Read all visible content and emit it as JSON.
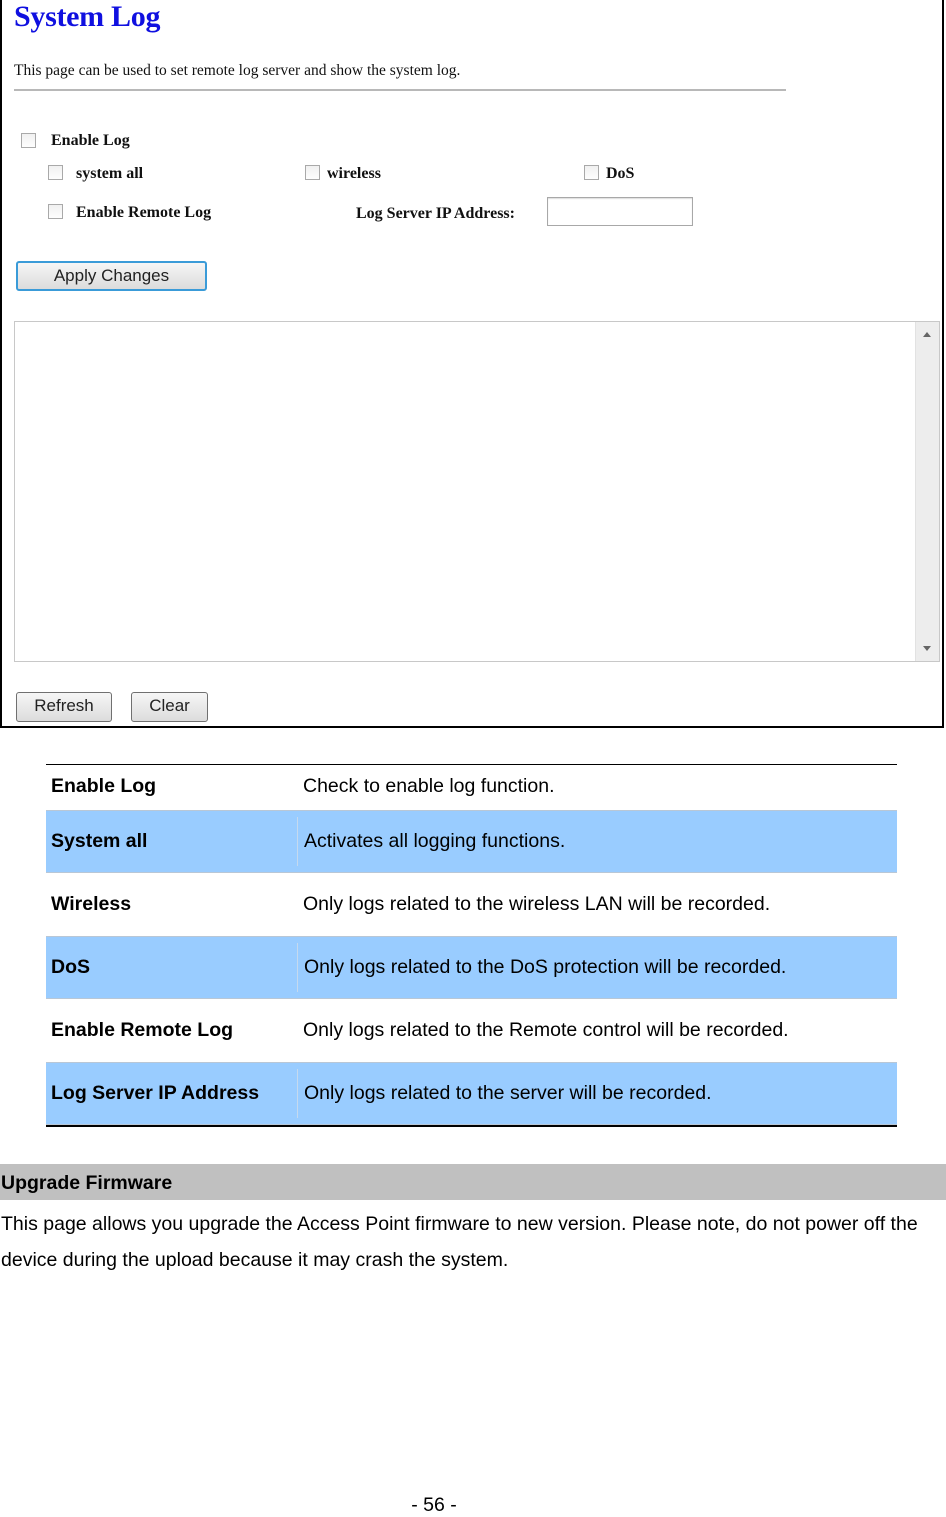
{
  "screenshot": {
    "title": "System Log",
    "description": "This page can be used to set remote log server and show the system log.",
    "options": {
      "enable_log": {
        "label": "Enable Log",
        "checked": false
      },
      "system_all": {
        "label": "system all",
        "checked": false
      },
      "wireless": {
        "label": "wireless",
        "checked": false
      },
      "dos": {
        "label": "DoS",
        "checked": false
      },
      "enable_remote_log": {
        "label": "Enable Remote Log",
        "checked": false
      },
      "log_server_ip": {
        "label": "Log Server IP Address:",
        "value": ""
      }
    },
    "apply_button": "Apply Changes",
    "log_content": "",
    "refresh_button": "Refresh",
    "clear_button": "Clear"
  },
  "table": {
    "rows": [
      {
        "term": "Enable Log",
        "definition": "Check to enable log function."
      },
      {
        "term": "System all",
        "definition": "Activates all logging functions."
      },
      {
        "term": "Wireless",
        "definition": "Only logs related to the wireless LAN will be recorded."
      },
      {
        "term": "DoS",
        "definition": "Only logs related to the DoS protection will be recorded."
      },
      {
        "term": "Enable Remote Log",
        "definition": "Only logs related to the Remote control will be recorded."
      },
      {
        "term": "Log Server IP Address",
        "definition": "Only logs related to the server will be recorded."
      }
    ],
    "highlight_color": "#99ccff"
  },
  "section": {
    "heading": "Upgrade Firmware",
    "body": "This page allows you upgrade the Access Point firmware to new version. Please note, do not power off the device during the upload because it may crash the system."
  },
  "footer": {
    "page_number": "- 56 -"
  }
}
